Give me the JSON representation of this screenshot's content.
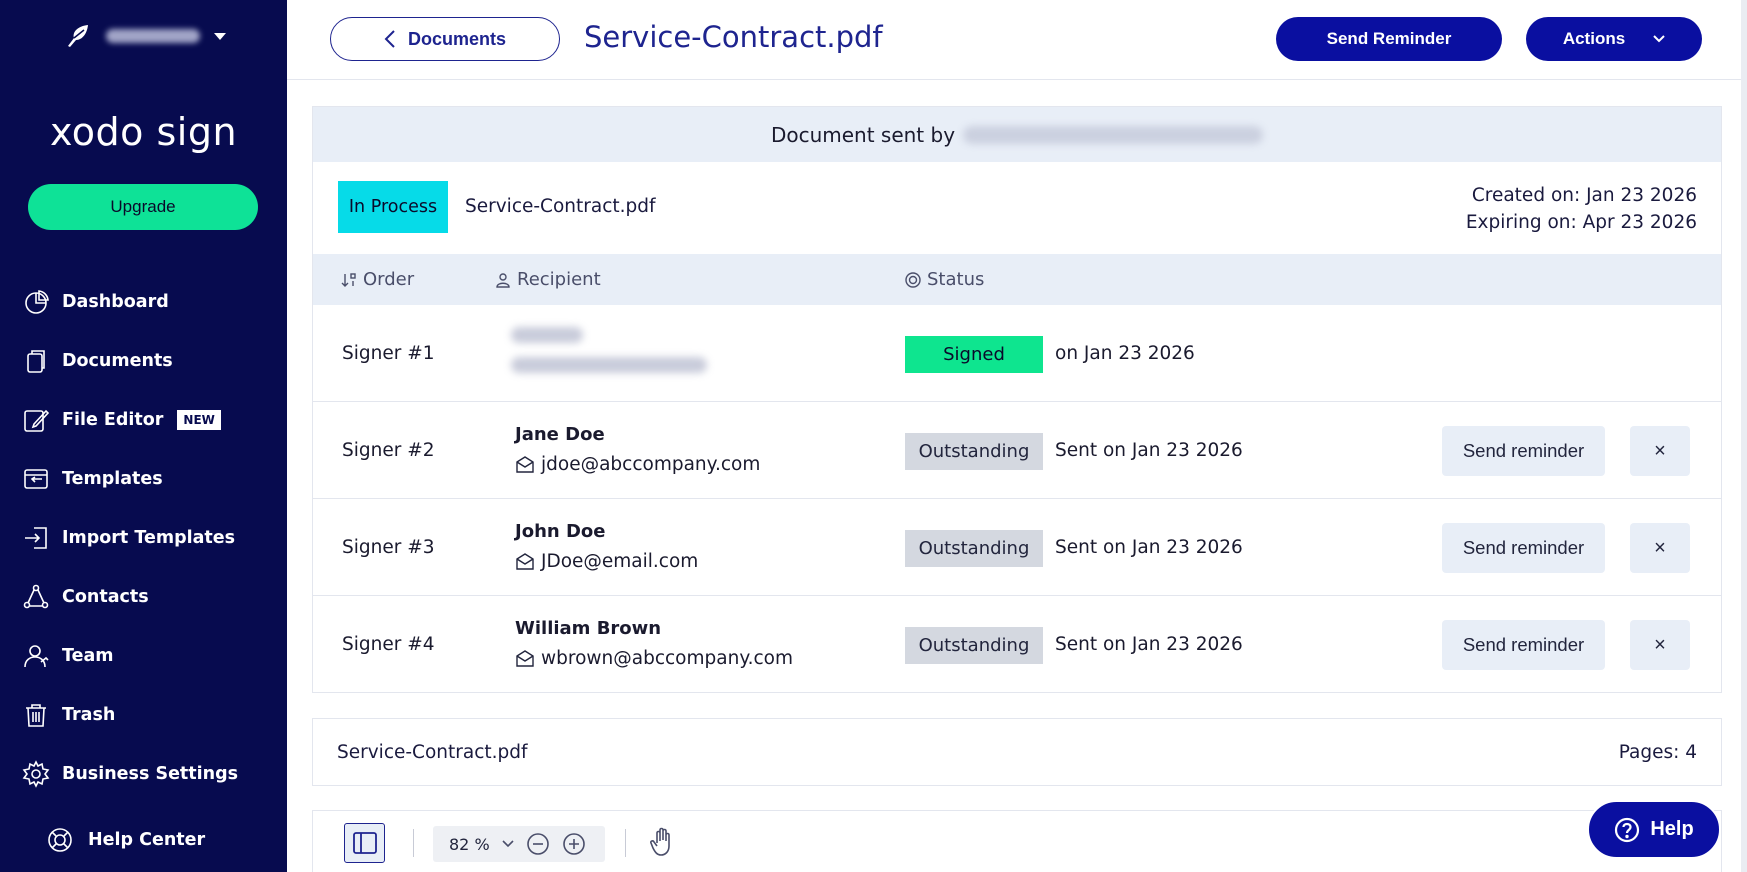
{
  "sidebar": {
    "brand": "xodo sign",
    "upgrade_label": "Upgrade",
    "items": [
      {
        "label": "Dashboard",
        "icon": "dashboard-icon"
      },
      {
        "label": "Documents",
        "icon": "documents-icon"
      },
      {
        "label": "File Editor",
        "icon": "file-editor-icon",
        "badge": "NEW"
      },
      {
        "label": "Templates",
        "icon": "templates-icon"
      },
      {
        "label": "Import Templates",
        "icon": "import-templates-icon"
      },
      {
        "label": "Contacts",
        "icon": "contacts-icon"
      },
      {
        "label": "Team",
        "icon": "team-icon"
      },
      {
        "label": "Trash",
        "icon": "trash-icon"
      },
      {
        "label": "Business Settings",
        "icon": "settings-icon"
      }
    ],
    "help_center": "Help Center"
  },
  "header": {
    "back_label": "Documents",
    "title": "Service-Contract.pdf",
    "send_reminder": "Send Reminder",
    "actions": "Actions"
  },
  "document": {
    "sent_by_label": "Document sent by",
    "status": "In Process",
    "file_name": "Service-Contract.pdf",
    "created": "Created on: Jan 23 2026",
    "expiring": "Expiring on: Apr 23 2026"
  },
  "table": {
    "headers": {
      "order": "Order",
      "recipient": "Recipient",
      "status": "Status"
    },
    "rows": [
      {
        "order": "Signer #1",
        "name": "",
        "email": "",
        "status": "Signed",
        "date": "on Jan 23 2026"
      },
      {
        "order": "Signer #2",
        "name": "Jane Doe",
        "email": "jdoe@abccompany.com",
        "status": "Outstanding",
        "date": "Sent on Jan 23 2026",
        "reminder": "Send reminder",
        "remove": "×"
      },
      {
        "order": "Signer #3",
        "name": "John Doe",
        "email": "JDoe@email.com",
        "status": "Outstanding",
        "date": "Sent on Jan 23 2026",
        "reminder": "Send reminder",
        "remove": "×"
      },
      {
        "order": "Signer #4",
        "name": "William Brown",
        "email": "wbrown@abccompany.com",
        "status": "Outstanding",
        "date": "Sent on Jan 23 2026",
        "reminder": "Send reminder",
        "remove": "×"
      }
    ]
  },
  "file_info": {
    "name": "Service-Contract.pdf",
    "pages": "Pages: 4"
  },
  "viewer": {
    "zoom": "82 %"
  },
  "help_button": "Help",
  "colors": {
    "sidebar": "#070b4f",
    "primary": "#0a0fa0",
    "upgrade": "#0ee297",
    "in_process": "#06dbe8",
    "signed": "#0ee58f",
    "outstanding": "#d4d8e0"
  }
}
